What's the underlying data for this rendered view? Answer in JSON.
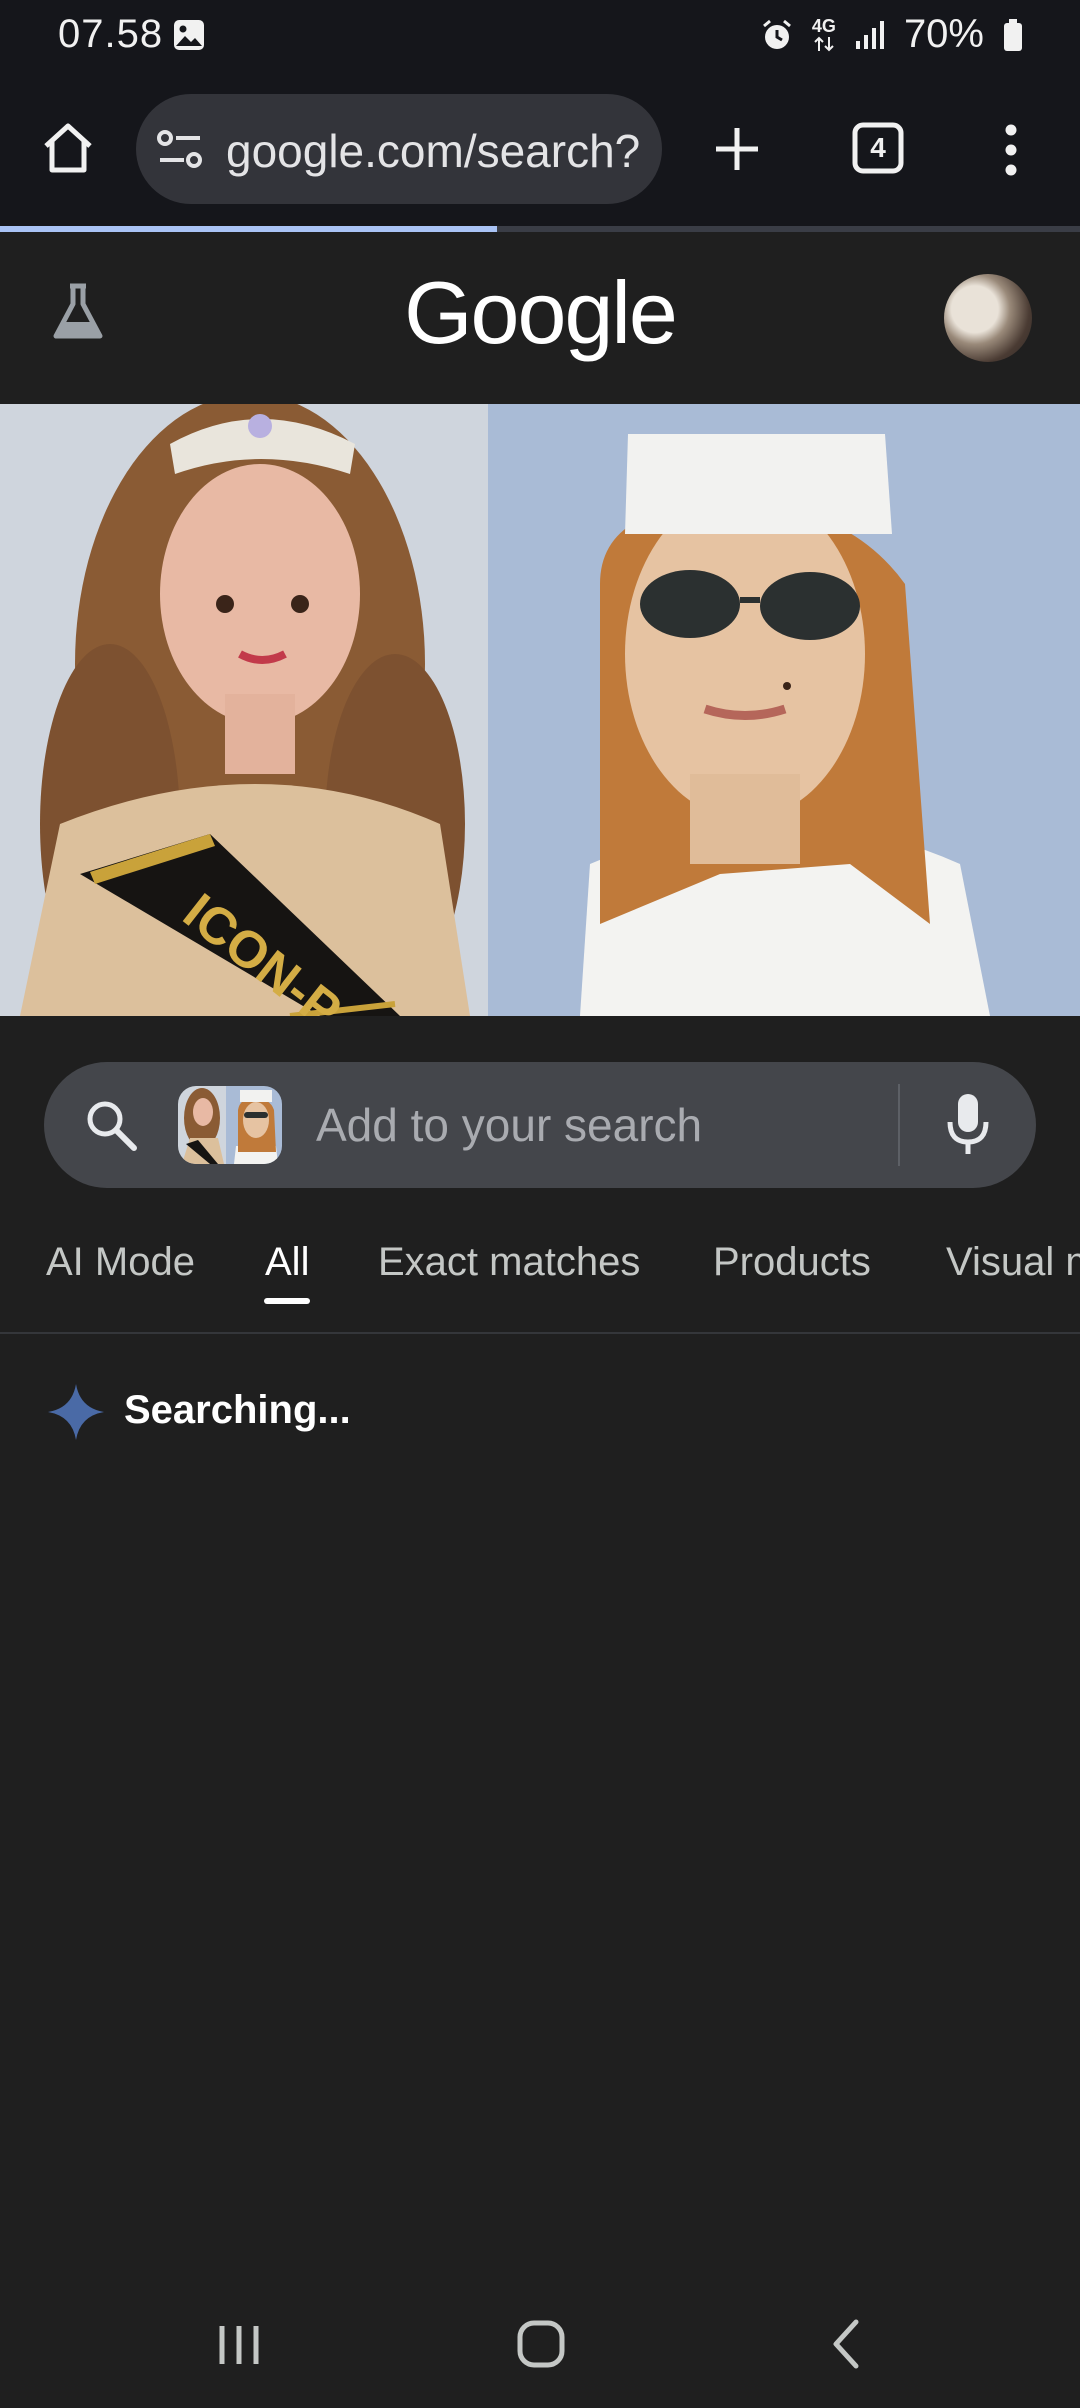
{
  "status_bar": {
    "time": "07.58",
    "network": "4G",
    "battery": "70%",
    "icons": [
      "image-icon",
      "alarm-icon",
      "data-arrows-icon",
      "signal-icon",
      "battery-icon"
    ]
  },
  "browser": {
    "url": "google.com/search?",
    "tab_count": "4",
    "load_progress": 0.46,
    "icons": [
      "home-icon",
      "site-settings-icon",
      "new-tab-icon",
      "tab-switcher-icon",
      "more-menu-icon"
    ]
  },
  "google": {
    "logo": "Google",
    "icons": [
      "labs-flask-icon",
      "account-avatar"
    ]
  },
  "query_image": {
    "description_icons": [
      "query-image-left",
      "query-image-right"
    ]
  },
  "search": {
    "placeholder": "Add to your search",
    "icons": [
      "search-icon",
      "query-thumbnail",
      "mic-icon"
    ]
  },
  "tabs": [
    {
      "label": "AI Mode",
      "active": false
    },
    {
      "label": "All",
      "active": true
    },
    {
      "label": "Exact matches",
      "active": false
    },
    {
      "label": "Products",
      "active": false
    },
    {
      "label": "Visual m",
      "active": false
    }
  ],
  "status": {
    "searching": "Searching..."
  },
  "nav": {
    "icons": [
      "recents-icon",
      "home-nav-icon",
      "back-icon"
    ]
  },
  "colors": {
    "background": "#1f1f1f",
    "toolbar": "#15161b",
    "progress": "#a9c3f5",
    "sparkle": "#4a6aa6"
  }
}
